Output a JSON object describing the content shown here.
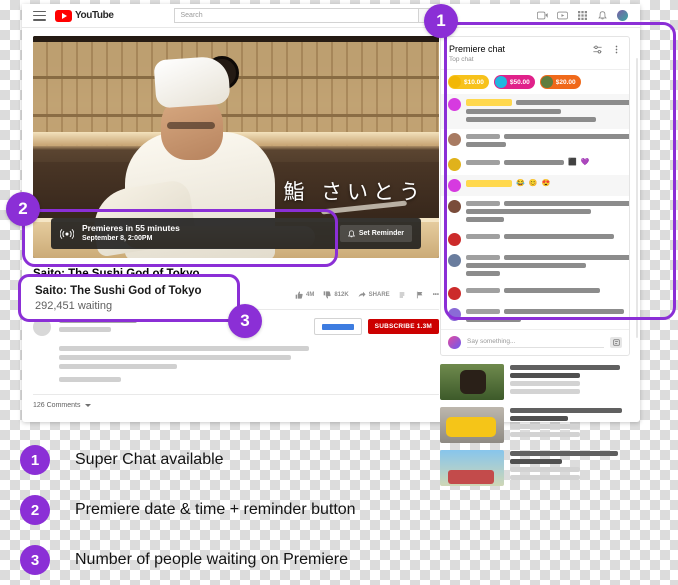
{
  "browser": {
    "header": {
      "menu_icon": "hamburger-menu-icon",
      "logo_text": "YouTube",
      "search_placeholder": "Search",
      "search_icon": "search-icon",
      "icons": [
        "create-video-icon",
        "youtube-apps-icon",
        "grid-apps-icon",
        "notifications-bell-icon",
        "account-avatar"
      ]
    }
  },
  "video": {
    "overlay_text": "鮨 さいとう",
    "premiere": {
      "live_icon": "broadcast-icon",
      "countdown": "Premieres in 55 minutes",
      "datetime": "September 8, 2:00PM",
      "reminder_label": "Set Reminder",
      "reminder_icon": "bell-icon"
    },
    "title": "Saito: The Sushi God of Tokyo",
    "waiting": "292,451 waiting",
    "actions": [
      {
        "icon": "thumbs-up-icon",
        "label": "4M"
      },
      {
        "icon": "thumbs-down-icon",
        "label": "812K"
      },
      {
        "icon": "share-icon",
        "label": "SHARE"
      },
      {
        "icon": "save-playlist-icon",
        "label": ""
      },
      {
        "icon": "flag-report-icon",
        "label": ""
      },
      {
        "icon": "more-options-icon",
        "label": "•••"
      }
    ],
    "channel": {
      "join_label": "",
      "subscribe_label": "SUBSCRIBE 1.3M"
    },
    "comments": {
      "count_label": "126 Comments",
      "sort_icon": "chevron-down-icon"
    }
  },
  "chat": {
    "title": "Premiere chat",
    "subtitle": "Top chat",
    "header_icons": [
      "chat-filter-icon",
      "chat-more-options-icon"
    ],
    "superchats": [
      {
        "amount": "$10.00",
        "color": "#f7c21b",
        "avatar": "#f2b705"
      },
      {
        "amount": "$50.00",
        "color": "#e0218a",
        "avatar": "#21b6e0"
      },
      {
        "amount": "$20.00",
        "color": "#f0691a",
        "avatar": "#5f7d3e"
      }
    ],
    "messages": [
      {
        "avatar": "#d63ae0",
        "highlight": true,
        "lines": [
          140,
          95,
          130
        ],
        "emojis": []
      },
      {
        "avatar": "#a87b62",
        "highlight": false,
        "lines": [
          140,
          40
        ],
        "emojis": []
      },
      {
        "avatar": "#e0b21b",
        "highlight": false,
        "lines": [
          60
        ],
        "emojis": [
          "⬛",
          "💜"
        ]
      },
      {
        "avatar": "#d63ae0",
        "highlight": true,
        "lines": [],
        "emojis": [
          "😂",
          "😊",
          "😍"
        ]
      },
      {
        "avatar": "#7a4c3a",
        "highlight": false,
        "lines": [
          140,
          125,
          38
        ],
        "emojis": []
      },
      {
        "avatar": "#cc2b2b",
        "highlight": false,
        "lines": [
          110
        ],
        "emojis": []
      },
      {
        "avatar": "#6a7d9e",
        "highlight": false,
        "lines": [
          140,
          120,
          34
        ],
        "emojis": []
      },
      {
        "avatar": "#cc2b2b",
        "highlight": false,
        "lines": [
          96
        ],
        "emojis": []
      },
      {
        "avatar": "#8a6bd6",
        "highlight": false,
        "lines": [
          120,
          55
        ],
        "emojis": []
      }
    ],
    "input_placeholder": "Say something...",
    "send_icon": "chat-send-icon"
  },
  "recommended": [
    {
      "thumb": "thumb-a",
      "title_w": 110,
      "sub_w": 70
    },
    {
      "thumb": "thumb-b",
      "title_w": 112,
      "sub_w": 58
    },
    {
      "thumb": "thumb-c",
      "title_w": 108,
      "sub_w": 52
    }
  ],
  "annotations": {
    "badges": [
      "1",
      "2",
      "3"
    ],
    "accent_color": "#8b2fd6",
    "legend": [
      {
        "number": "1",
        "text": "Super Chat available"
      },
      {
        "number": "2",
        "text": "Premiere date & time + reminder button"
      },
      {
        "number": "3",
        "text": "Number of people waiting on Premiere"
      }
    ]
  }
}
